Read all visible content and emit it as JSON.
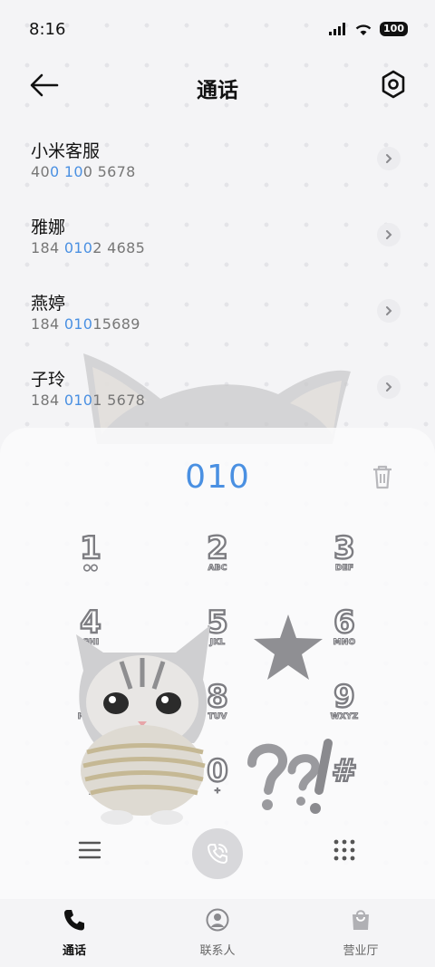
{
  "status_bar": {
    "time": "8:16",
    "battery": "100"
  },
  "header": {
    "title": "通话",
    "back_icon": "arrow-left-icon",
    "settings_icon": "hexagon-gear-icon"
  },
  "contacts": [
    {
      "name": "小米客服",
      "number_parts": [
        "40",
        "0 10",
        "0 5678"
      ]
    },
    {
      "name": "雅娜",
      "number_parts": [
        "184 ",
        "010",
        "2 4685"
      ]
    },
    {
      "name": "燕婷",
      "number_parts": [
        "184 ",
        "010",
        "15689"
      ]
    },
    {
      "name": "子玲",
      "number_parts": [
        "184 ",
        "010",
        "1 5678"
      ]
    }
  ],
  "dialer": {
    "input": "010",
    "keys": [
      {
        "digit": "1",
        "letters": "◌◌"
      },
      {
        "digit": "2",
        "letters": "ABC"
      },
      {
        "digit": "3",
        "letters": "DEF"
      },
      {
        "digit": "4",
        "letters": "GHI"
      },
      {
        "digit": "5",
        "letters": "JKL"
      },
      {
        "digit": "6",
        "letters": "MNO"
      },
      {
        "digit": "7",
        "letters": "PQRS"
      },
      {
        "digit": "8",
        "letters": "TUV"
      },
      {
        "digit": "9",
        "letters": "WXYZ"
      },
      {
        "digit": "*",
        "letters": ","
      },
      {
        "digit": "0",
        "letters": "+"
      },
      {
        "digit": "#",
        "letters": ""
      }
    ]
  },
  "nav": {
    "tabs": [
      {
        "label": "通话",
        "icon": "phone-icon",
        "active": true
      },
      {
        "label": "联系人",
        "icon": "person-icon",
        "active": false
      },
      {
        "label": "营业厅",
        "icon": "shopping-bag-icon",
        "active": false
      }
    ]
  },
  "colors": {
    "accent": "#4a90e2",
    "key_outline": "#7d7d82",
    "background": "#f4f4f6"
  }
}
